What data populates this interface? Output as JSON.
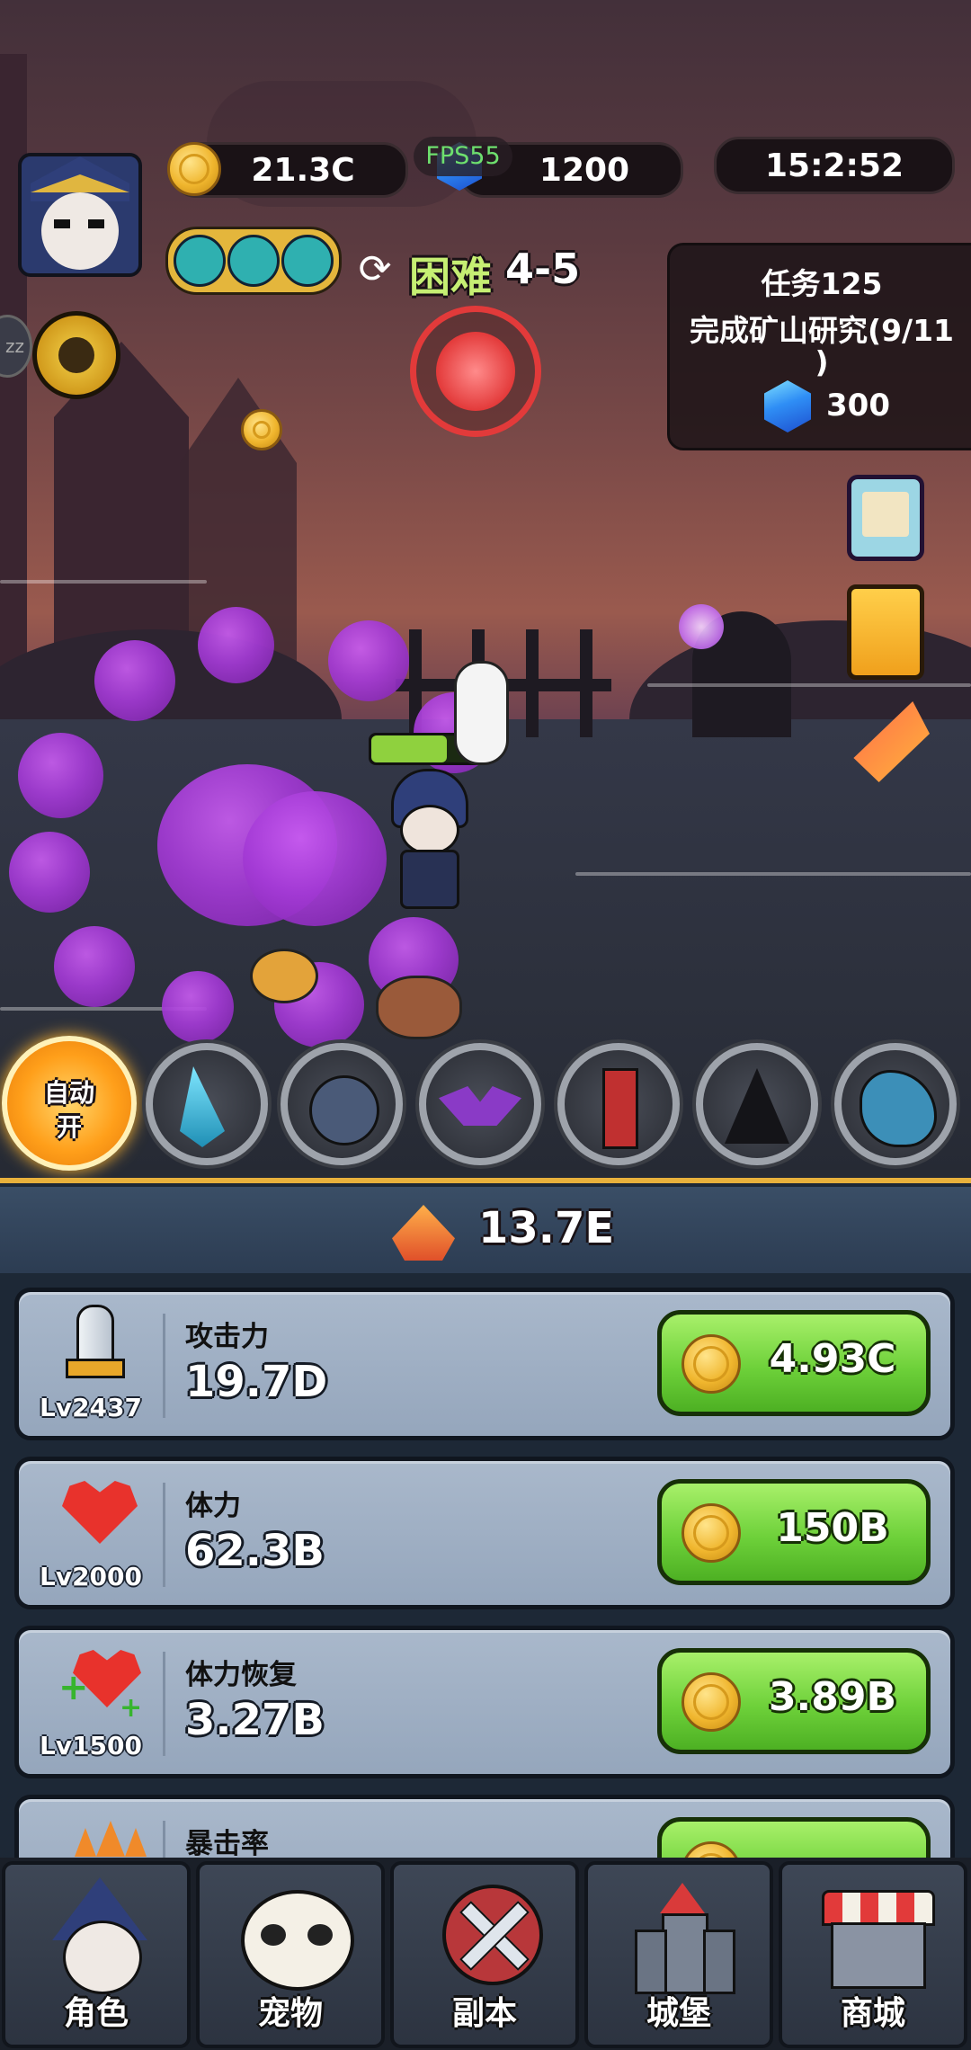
{
  "hud": {
    "coins": "21.3C",
    "fps": "FPS55",
    "gems": "1200",
    "timer": "15:2:52",
    "difficulty": "困难",
    "stage": "4-5",
    "sleep_badge": "zz"
  },
  "quest": {
    "title": "任务125",
    "desc_line1": "完成矿山研究(9/11",
    "desc_line2": ")",
    "reward": "300"
  },
  "skills": {
    "auto_line1": "自动",
    "auto_line2": "开",
    "icons": [
      "ice-shard-icon",
      "bomb-icon",
      "bat-wings-icon",
      "totem-icon",
      "dark-cloak-icon",
      "dragon-icon"
    ]
  },
  "power": {
    "value": "13.7E"
  },
  "upgrades": [
    {
      "icon": "sword-icon",
      "level": "Lv2437",
      "name": "攻击力",
      "value": "19.7D",
      "price": "4.93C"
    },
    {
      "icon": "heart-icon",
      "level": "Lv2000",
      "name": "体力",
      "value": "62.3B",
      "price": "150B"
    },
    {
      "icon": "heart-regen-icon",
      "level": "Lv1500",
      "name": "体力恢复",
      "value": "3.27B",
      "price": "3.89B"
    },
    {
      "icon": "crit-icon",
      "level": "",
      "name": "暴击率",
      "value": "",
      "price": ""
    }
  ],
  "nav": [
    {
      "label": "角色",
      "icon": "character-icon"
    },
    {
      "label": "宠物",
      "icon": "panda-pet-icon"
    },
    {
      "label": "副本",
      "icon": "crossed-swords-icon"
    },
    {
      "label": "城堡",
      "icon": "castle-icon"
    },
    {
      "label": "商城",
      "icon": "shop-icon"
    }
  ],
  "colors": {
    "accent_gold": "#e8b13c",
    "buy_green": "#6ed13a",
    "smoke_purple": "#a43ad6",
    "boss_red": "#e23a3a"
  }
}
